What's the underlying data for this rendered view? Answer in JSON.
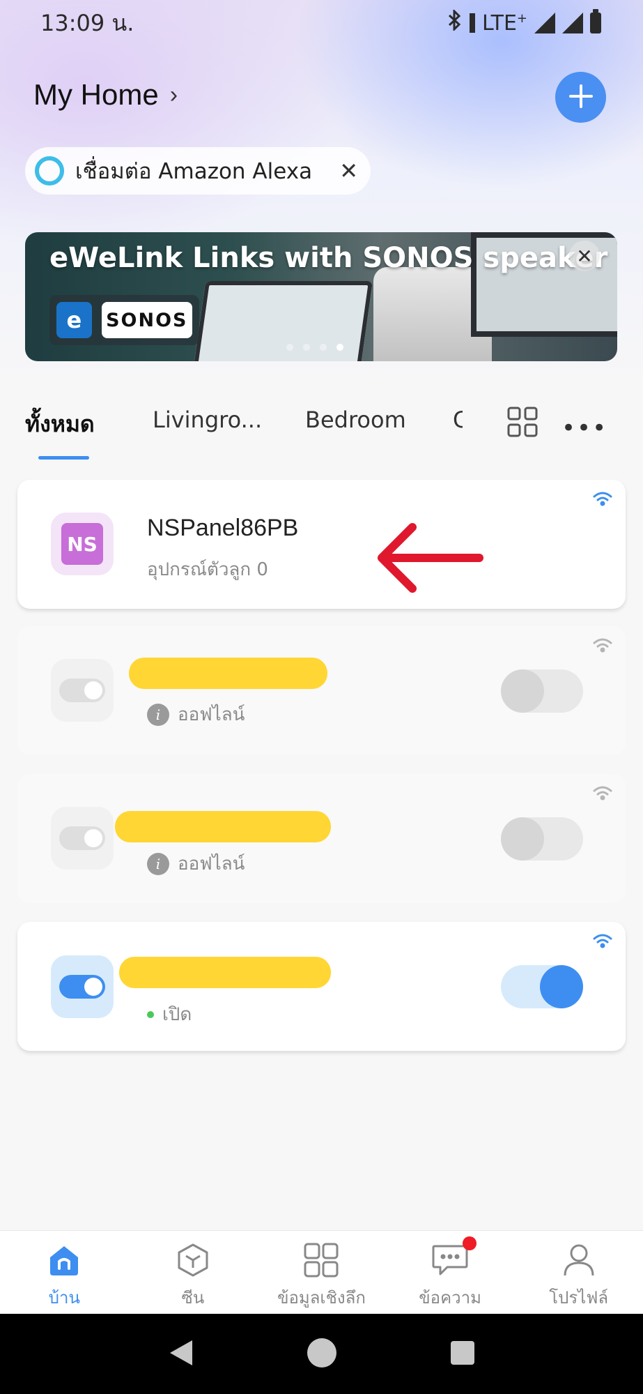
{
  "status_bar": {
    "time": "13:09 น.",
    "network": "LTE",
    "network_sup": "+"
  },
  "header": {
    "home_title": "My Home",
    "chevron": "›"
  },
  "alexa": {
    "label": "เชื่อมต่อ Amazon Alexa",
    "close": "✕"
  },
  "banner": {
    "title": "eWeLink Links with SONOS speaker",
    "ewelink_badge": "e",
    "sonos_badge": "SONOS",
    "close": "✕",
    "slide_count": 4,
    "active_slide": 4
  },
  "tabs": {
    "items": [
      "ทั้งหมด",
      "Livingro...",
      "Bedroom",
      "C"
    ],
    "active_index": 0,
    "more": "•••"
  },
  "devices": [
    {
      "name": "NSPanel86PB",
      "subtitle": "อุปกรณ์ตัวลูก 0",
      "icon_text": "NS",
      "status": "online"
    },
    {
      "name": "",
      "status_text": "ออฟไลน์",
      "status": "offline",
      "toggle_on": false
    },
    {
      "name": "",
      "status_text": "ออฟไลน์",
      "status": "offline",
      "toggle_on": false
    },
    {
      "name": "",
      "status_text": "เปิด",
      "status": "on",
      "toggle_on": true
    }
  ],
  "info_glyph": "i",
  "bottom_nav": [
    {
      "label": "บ้าน",
      "icon": "home-icon",
      "active": true
    },
    {
      "label": "ซีน",
      "icon": "scene-cube-icon",
      "active": false
    },
    {
      "label": "ข้อมูลเชิงลึก",
      "icon": "insights-grid-icon",
      "active": false
    },
    {
      "label": "ข้อความ",
      "icon": "message-bubble-icon",
      "active": false,
      "badge": true
    },
    {
      "label": "โปรไฟล์",
      "icon": "profile-person-icon",
      "active": false
    }
  ],
  "colors": {
    "accent": "#3d8ef0",
    "redaction": "#ffd633",
    "arrow": "#e0182d",
    "ns_icon": "#c86ed8",
    "online_dot": "#4cc85a"
  }
}
